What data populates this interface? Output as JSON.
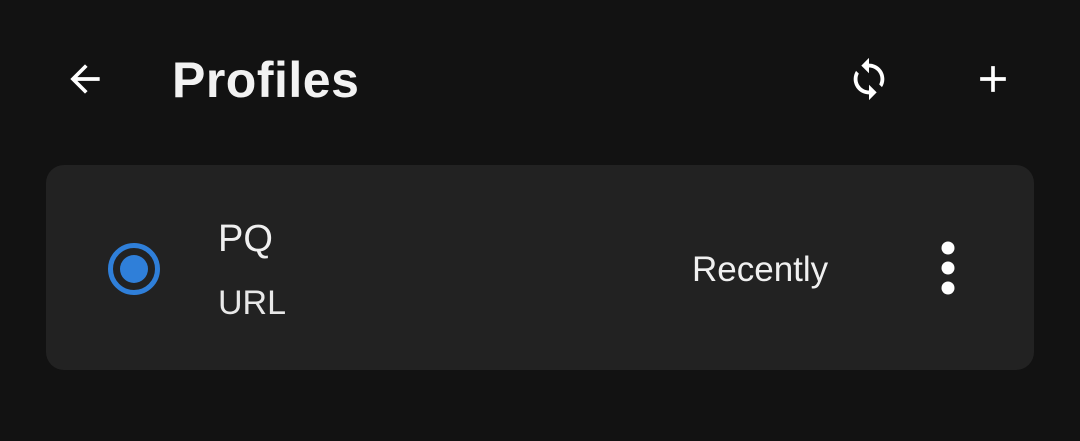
{
  "header": {
    "title": "Profiles",
    "back_icon": "arrow-left-icon",
    "sync_icon": "sync-icon",
    "add_icon": "plus-icon"
  },
  "profiles": [
    {
      "name": "PQ",
      "type": "URL",
      "updated": "Recently",
      "selected": true,
      "menu_icon": "more-vertical-icon"
    }
  ],
  "colors": {
    "background": "#121212",
    "card": "#222222",
    "accent": "#2f7fd9",
    "text": "#ffffff"
  }
}
